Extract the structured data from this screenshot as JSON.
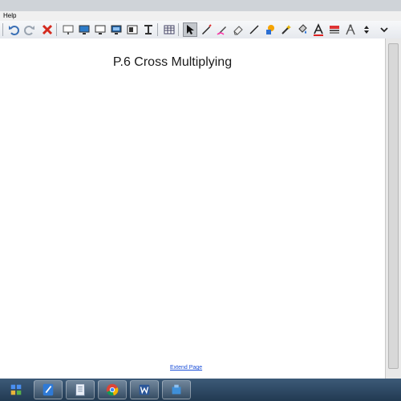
{
  "menubar": {
    "help_label": "Help"
  },
  "toolbar": {
    "tools": [
      "undo-icon",
      "redo-icon",
      "delete-icon",
      "screen-shade-icon",
      "display-icon",
      "monitor-icon",
      "screen-capture-icon",
      "table-icon",
      "text-tool-icon",
      "grid-icon",
      "select-arrow-icon",
      "pen-icon",
      "creative-pen-icon",
      "eraser-icon",
      "line-icon",
      "shape-icon",
      "magic-pen-icon",
      "fill-icon",
      "text-icon",
      "properties-icon",
      "measurement-icon",
      "more-arrows-icon"
    ]
  },
  "canvas": {
    "title": "P.6 Cross Multiplying",
    "extend_page_label": "Extend Page"
  },
  "taskbar": {
    "items": [
      "start-icon",
      "notebook-icon",
      "file-explorer-icon",
      "chrome-icon",
      "word-icon",
      "app-icon"
    ]
  },
  "colors": {
    "link": "#1b4fd8",
    "taskbar": "#2d4763",
    "toolbar_bg": "#eef0f3"
  }
}
